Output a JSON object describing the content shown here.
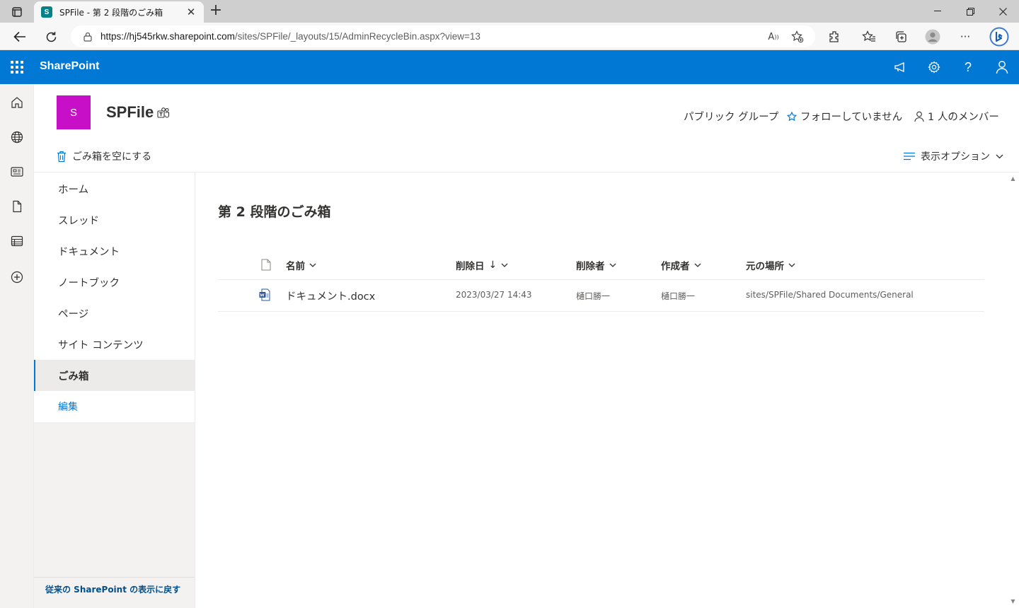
{
  "browser": {
    "tab_title": "SPFile - 第 2 段階のごみ箱",
    "tab_favicon_letter": "S",
    "url_host": "https://hj545rkw.sharepoint.com",
    "url_path": "/sites/SPFile/_layouts/15/AdminRecycleBin.aspx?view=13"
  },
  "suite": {
    "app_name": "SharePoint"
  },
  "site": {
    "logo_letter": "S",
    "name": "SPFile",
    "group_type": "パブリック グループ",
    "follow_label": "フォローしていません",
    "members_label": "1 人のメンバー"
  },
  "commands": {
    "empty_recycle_bin": "ごみ箱を空にする",
    "view_options": "表示オプション"
  },
  "nav": {
    "items": [
      {
        "label": "ホーム"
      },
      {
        "label": "スレッド"
      },
      {
        "label": "ドキュメント"
      },
      {
        "label": "ノートブック"
      },
      {
        "label": "ページ"
      },
      {
        "label": "サイト コンテンツ"
      },
      {
        "label": "ごみ箱"
      }
    ],
    "edit_label": "編集",
    "footer_link": "従来の SharePoint の表示に戻す"
  },
  "main": {
    "title": "第 2 段階のごみ箱",
    "columns": {
      "name": "名前",
      "deleted_date": "削除日",
      "sort_arrow": "↓",
      "deleted_by": "削除者",
      "created_by": "作成者",
      "original_location": "元の場所"
    },
    "rows": [
      {
        "name": "ドキュメント.docx",
        "deleted_date": "2023/03/27 14:43",
        "deleted_by": "樋口勝一",
        "created_by": "樋口勝一",
        "original_location": "sites/SPFile/Shared Documents/General"
      }
    ]
  },
  "colors": {
    "suite_bar": "#0078d4",
    "site_logo": "#c80fc8",
    "nav_selected_bg": "#edebe9",
    "link": "#0078d4"
  }
}
